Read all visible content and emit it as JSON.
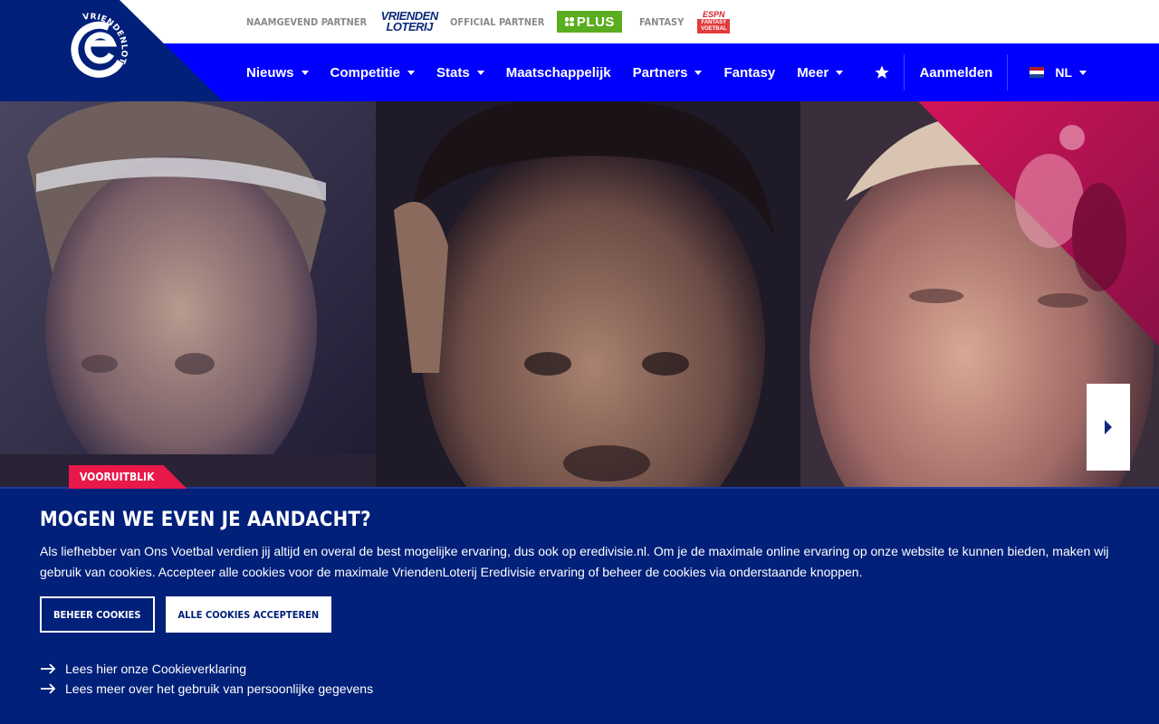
{
  "partners": [
    {
      "label": "Naamgevend partner",
      "logo": "vriendenloterij-logo",
      "logo_lines": [
        "VRIENDEN",
        "LOTERIJ"
      ]
    },
    {
      "label": "Official partner",
      "logo": "plus-logo",
      "logo_text": "PLUS"
    },
    {
      "label": "Fantasy",
      "logo": "espn-fantasy-logo",
      "logo_lines": [
        "ESPN",
        "FANTASY VOETBAL"
      ]
    }
  ],
  "brand": {
    "logo": "eredivisie-logo",
    "arc_text": "VRIENDENLOTERIJ"
  },
  "nav": {
    "items": [
      {
        "label": "Nieuws",
        "dropdown": true
      },
      {
        "label": "Competitie",
        "dropdown": true
      },
      {
        "label": "Stats",
        "dropdown": true
      },
      {
        "label": "Maatschappelijk",
        "dropdown": false
      },
      {
        "label": "Partners",
        "dropdown": true
      },
      {
        "label": "Fantasy",
        "dropdown": false
      },
      {
        "label": "Meer",
        "dropdown": true
      }
    ],
    "favorites_icon": "star-icon",
    "login": "Aanmelden",
    "language": "NL",
    "flag_colors": [
      "#ae1c28",
      "#ffffff",
      "#21468b"
    ]
  },
  "hero": {
    "tag": "Vooruitblik",
    "next_icon": "chevron-right-icon"
  },
  "cookie": {
    "title": "Mogen we even je aandacht?",
    "text": "Als liefhebber van Ons Voetbal verdien jij altijd en overal de best mogelijke ervaring, dus ook op eredivisie.nl. Om je de maximale online ervaring op onze website te kunnen bieden, maken wij gebruik van cookies. Accepteer alle cookies voor de maximale VriendenLoterij Eredivisie ervaring of beheer de cookies via onderstaande knoppen.",
    "manage_button": "Beheer cookies",
    "accept_button": "Alle cookies accepteren",
    "links": [
      "Lees hier onze Cookieverklaring",
      "Lees meer over het gebruik van persoonlijke gegevens"
    ]
  },
  "colors": {
    "nav_blue": "#0000ff",
    "navy": "#00207a",
    "accent_pink": "#e8194a",
    "plus_green": "#5aad1e"
  }
}
